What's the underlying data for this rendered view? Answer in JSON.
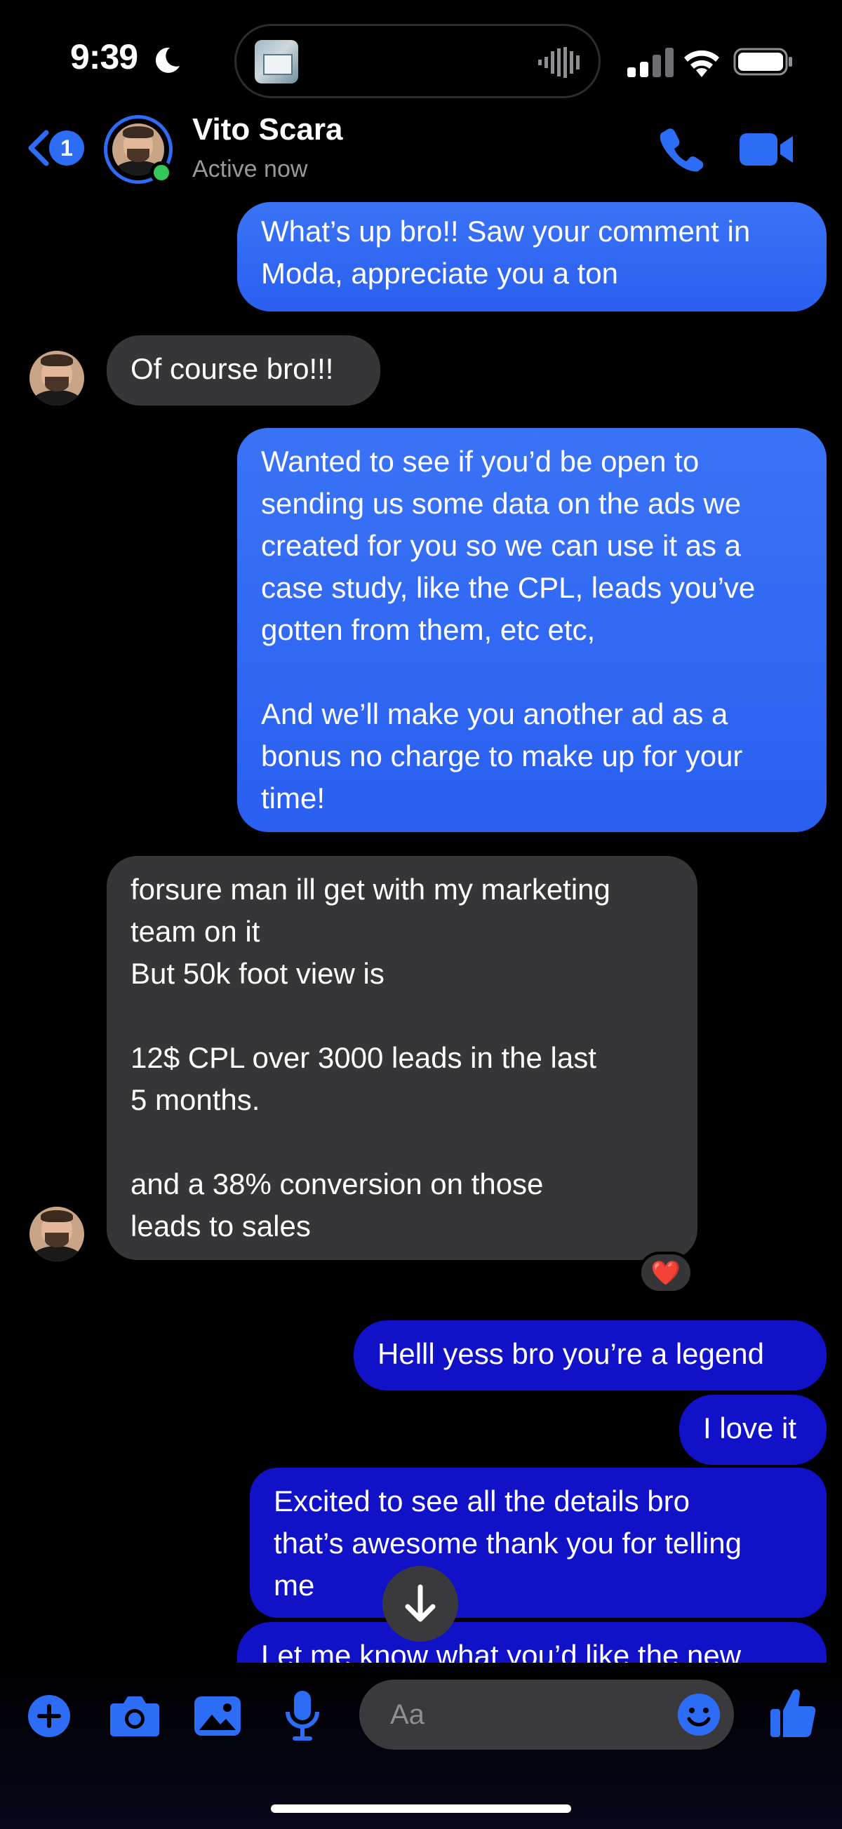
{
  "status_bar": {
    "time": "9:39"
  },
  "header": {
    "unread_count": "1",
    "contact_name": "Vito Scara",
    "contact_status": "Active now"
  },
  "messages": [
    {
      "side": "sent",
      "text": "What’s up bro!! Saw your comment in\nModa, appreciate you a ton"
    },
    {
      "side": "received",
      "text": "Of course bro!!!"
    },
    {
      "side": "sent",
      "text": "Wanted to see if you’d be open to\nsending us some data on the ads we\ncreated for you so we can use it as a\ncase study, like the CPL, leads you’ve\ngotten from them, etc etc,\n\nAnd we’ll make you another ad as a\nbonus no charge to make up for your\ntime!"
    },
    {
      "side": "received",
      "text": "forsure man ill get with my marketing\nteam on it\nBut 50k foot view is\n\n12$ CPL over 3000 leads in the last\n5 months.\n\nand a 38% conversion on those\nleads to sales",
      "reaction": "❤️"
    },
    {
      "side": "sent",
      "text": "Helll yess bro you’re a legend"
    },
    {
      "side": "sent",
      "text": "I love it"
    },
    {
      "side": "sent",
      "text": "Excited to see all the details bro\nthat’s awesome thank you for telling\nme"
    },
    {
      "side": "sent",
      "text": "Let me know what you’d like the new"
    }
  ],
  "composer": {
    "placeholder": "Aa",
    "icons": [
      "plus-icon",
      "camera-icon",
      "photo-icon",
      "microphone-icon",
      "emoji-icon",
      "thumbs-up-icon"
    ]
  },
  "colors": {
    "accent": "#2d6cf4",
    "sent_bubble_top": "#3a73f6",
    "sent_bubble_recent": "#1111c8",
    "received_bubble": "#363638",
    "online": "#34c759"
  }
}
